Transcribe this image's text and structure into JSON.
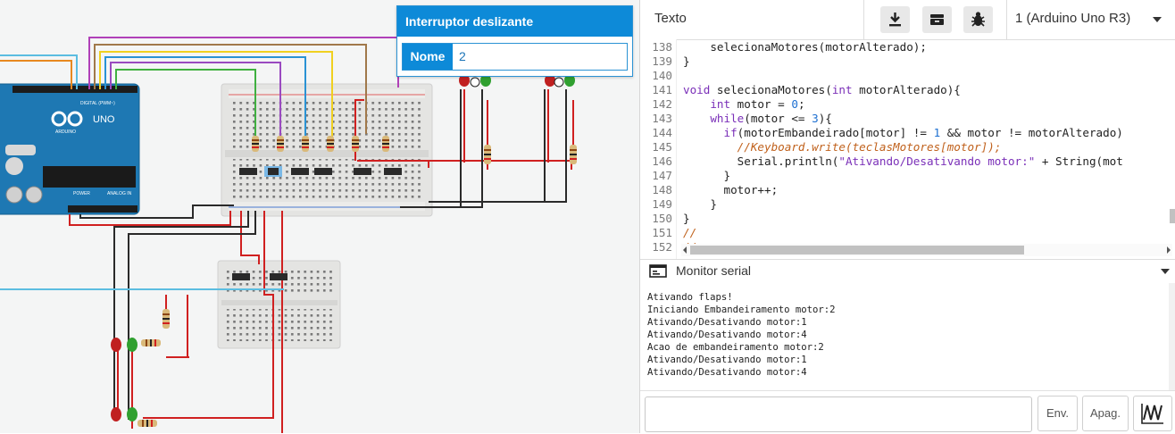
{
  "inspector": {
    "title": "Interruptor deslizante",
    "name_label": "Nome",
    "name_value": "2"
  },
  "board_labels": {
    "arduino_brand": "UNO",
    "arduino_sub": "ARDUINO",
    "digital": "DIGITAL (PWM~)",
    "analog": "ANALOG IN",
    "power": "POWER"
  },
  "toolbar": {
    "mode_label": "Texto",
    "download_icon": "download-icon",
    "library_icon": "library-icon",
    "debug_icon": "bug-icon",
    "board_select": "1 (Arduino Uno R3)"
  },
  "code": {
    "line_numbers": [
      "138",
      "139",
      "140",
      "141",
      "142",
      "143",
      "144",
      "145",
      "146",
      "147",
      "148",
      "149",
      "150",
      "151",
      "152"
    ]
  },
  "serial": {
    "title": "Monitor serial",
    "lines": [
      "Ativando flaps!",
      "Iniciando Embandeiramento motor:2",
      "Ativando/Desativando motor:1",
      "Ativando/Desativando motor:4",
      "Acao de embandeiramento motor:2",
      "Ativando/Desativando motor:1",
      "Ativando/Desativando motor:4"
    ],
    "send_label": "Env.",
    "clear_label": "Apag.",
    "graph_icon": "waveform-icon"
  }
}
